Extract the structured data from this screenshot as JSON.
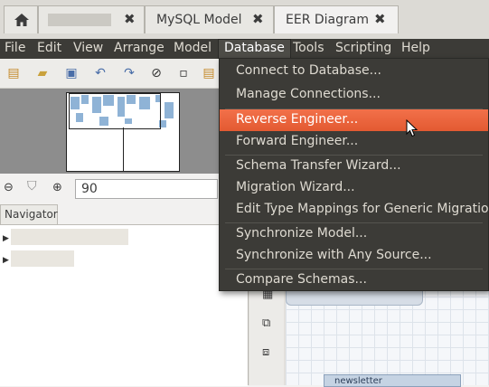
{
  "tabs": [
    {
      "label": "",
      "kind": "home"
    },
    {
      "label": "",
      "kind": "blurred"
    },
    {
      "label": "MySQL Model"
    },
    {
      "label": "EER Diagram"
    }
  ],
  "menubar": [
    "File",
    "Edit",
    "View",
    "Arrange",
    "Model",
    "Database",
    "Tools",
    "Scripting",
    "Help"
  ],
  "database_menu": {
    "groups": [
      [
        "Connect to Database...",
        "Manage Connections..."
      ],
      [
        "Reverse Engineer...",
        "Forward Engineer..."
      ],
      [
        "Schema Transfer Wizard...",
        "Migration Wizard...",
        "Edit Type Mappings for Generic Migration..."
      ],
      [
        "Synchronize Model...",
        "Synchronize with Any Source..."
      ],
      [
        "Compare Schemas..."
      ]
    ],
    "highlighted": "Reverse Engineer..."
  },
  "zoom": {
    "value": "90"
  },
  "navigator": {
    "tab_label": "Navigator"
  },
  "canvas": {
    "table_label": "newsletter"
  },
  "colors": {
    "highlight": "#e9603a",
    "menubar_bg": "#3c3b37",
    "tab_bg": "#dcdad5"
  }
}
